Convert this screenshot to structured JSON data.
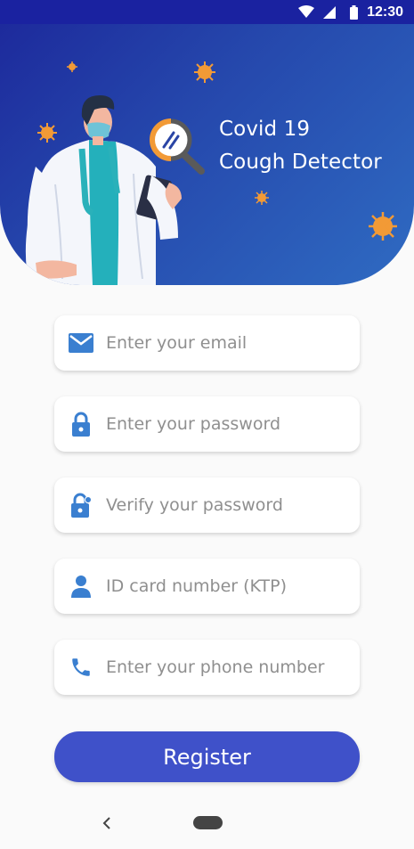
{
  "status_bar": {
    "time": "12:30",
    "icons": [
      "wifi-icon",
      "cellular-signal-icon",
      "battery-icon"
    ]
  },
  "header": {
    "title_line1": "Covid 19",
    "title_line2": "Cough Detector",
    "illustration": [
      "doctor-illustration",
      "magnifier-icon",
      "virus-icon"
    ]
  },
  "form": {
    "email": {
      "placeholder": "Enter your email",
      "value": "",
      "icon": "email-icon"
    },
    "password": {
      "placeholder": "Enter your password",
      "value": "",
      "icon": "lock-icon"
    },
    "verify_password": {
      "placeholder": "Verify your password",
      "value": "",
      "icon": "lock-check-icon"
    },
    "id_card": {
      "placeholder": "ID card number (KTP)",
      "value": "",
      "icon": "person-icon"
    },
    "phone": {
      "placeholder": "Enter your phone number",
      "value": "",
      "icon": "phone-icon"
    },
    "register_label": "Register"
  },
  "nav": {
    "icons": [
      "back-icon",
      "home-pill-icon"
    ]
  },
  "colors": {
    "status_bar": "#1a22a0",
    "header_start": "#1d2a9c",
    "header_end": "#2f6bc2",
    "accent_blue": "#3a7fd0",
    "button": "#3f51c9",
    "virus_orange": "#f29a36"
  }
}
